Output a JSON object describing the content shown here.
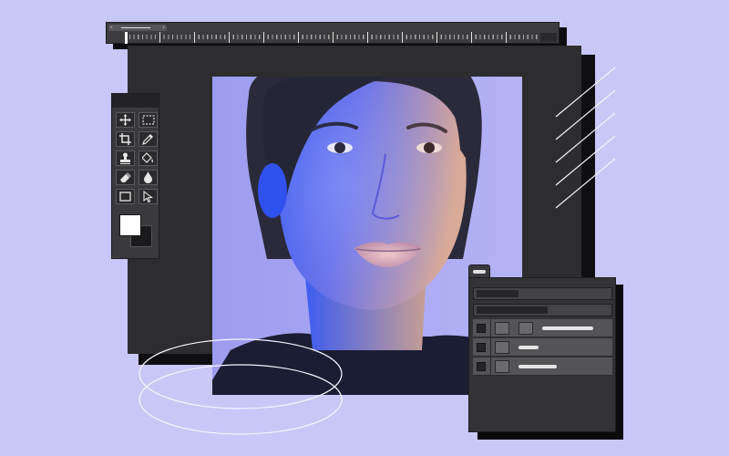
{
  "app": {
    "type": "photo-editor-illustration",
    "colors": {
      "background": "#c9c6f8",
      "panel": "#3a3a3c",
      "canvas": "#2d2d2f",
      "shadow": "#0f0f11",
      "foreground_color": "#ffffff",
      "background_color": "#1a1a1c"
    }
  },
  "ruler": {
    "icons": [
      "chevron-left-icon",
      "chevron-right-icon"
    ],
    "slider_left": "‹",
    "slider_right": "›"
  },
  "tools": [
    {
      "name": "move-tool-icon"
    },
    {
      "name": "marquee-tool-icon"
    },
    {
      "name": "crop-tool-icon"
    },
    {
      "name": "eyedropper-tool-icon"
    },
    {
      "name": "stamp-tool-icon"
    },
    {
      "name": "paint-bucket-tool-icon"
    },
    {
      "name": "eraser-tool-icon"
    },
    {
      "name": "blur-drop-tool-icon"
    },
    {
      "name": "rectangle-tool-icon"
    },
    {
      "name": "select-arrow-tool-icon"
    }
  ],
  "layers": {
    "rows": 3,
    "icons": [
      "visibility-icon",
      "layer-thumbnail-icon",
      "layer-mask-icon"
    ]
  }
}
